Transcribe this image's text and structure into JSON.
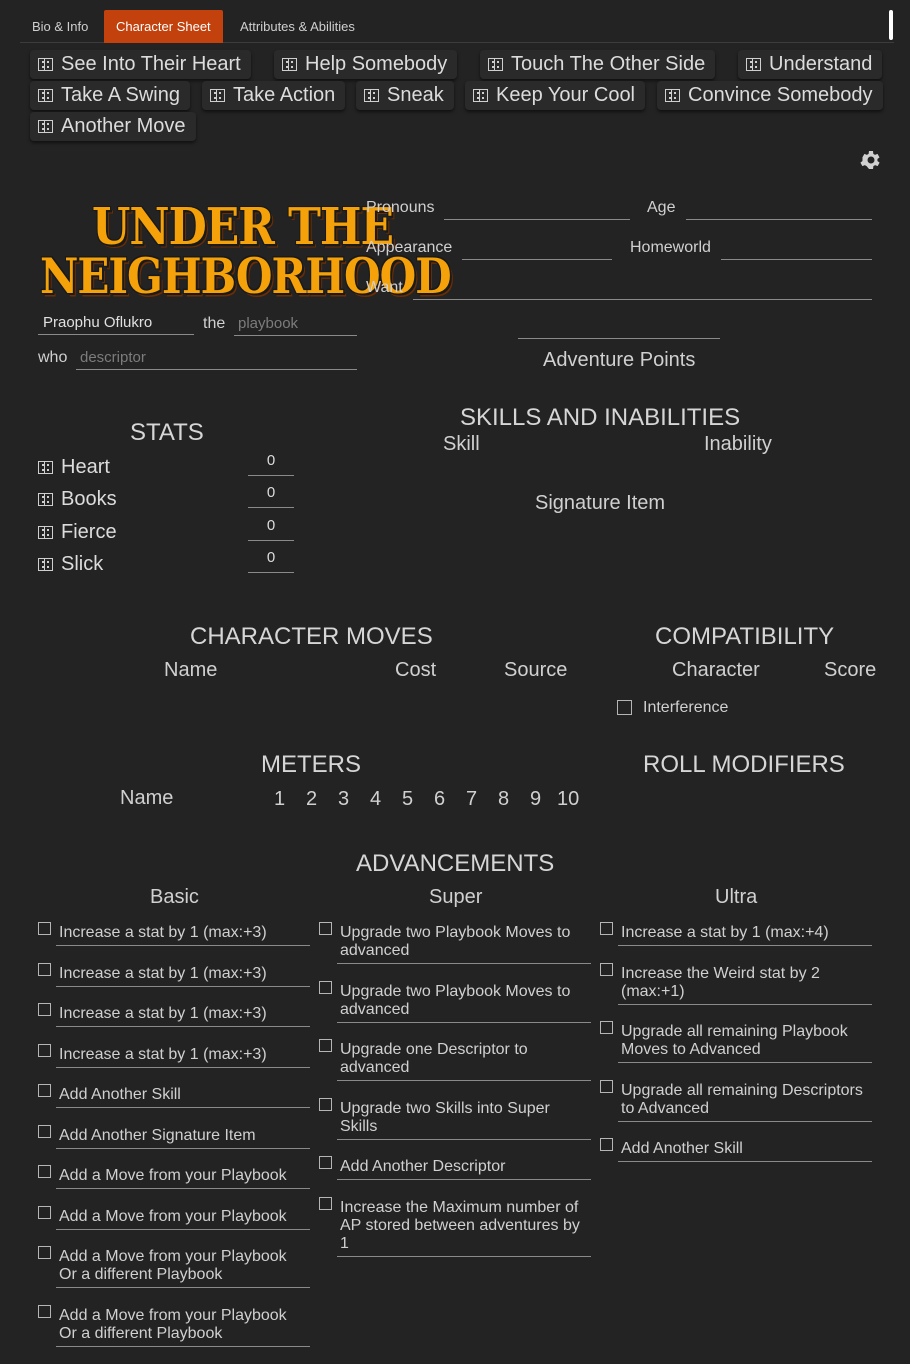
{
  "tabs": [
    "Bio & Info",
    "Character Sheet",
    "Attributes & Abilities"
  ],
  "active_tab": "Character Sheet",
  "moves": [
    "See Into Their Heart",
    "Help Somebody",
    "Touch The Other Side",
    "Understand",
    "Take A Swing",
    "Take Action",
    "Sneak",
    "Keep Your Cool",
    "Convince Somebody",
    "Another Move"
  ],
  "logo": {
    "line1": "UNDER THE",
    "line2": "NEIGHBORHOOD"
  },
  "character": {
    "name": "Praophu Oflukro",
    "the_label": "the",
    "playbook_placeholder": "playbook",
    "who_label": "who",
    "descriptor_placeholder": "descriptor"
  },
  "bio_fields": {
    "pronouns": "Pronouns",
    "age": "Age",
    "appearance": "Appearance",
    "homeworld": "Homeworld",
    "want": "Want"
  },
  "adventure_points_label": "Adventure Points",
  "stats": {
    "title": "STATS",
    "items": [
      {
        "name": "Heart",
        "value": "0"
      },
      {
        "name": "Books",
        "value": "0"
      },
      {
        "name": "Fierce",
        "value": "0"
      },
      {
        "name": "Slick",
        "value": "0"
      }
    ]
  },
  "skills": {
    "title": "SKILLS AND INABILITIES",
    "skill_col": "Skill",
    "inability_col": "Inability",
    "signature_item": "Signature Item"
  },
  "character_moves": {
    "title": "CHARACTER MOVES",
    "cols": [
      "Name",
      "Cost",
      "Source"
    ]
  },
  "compatibility": {
    "title": "COMPATIBILITY",
    "cols": [
      "Character",
      "Score"
    ],
    "interference": "Interference"
  },
  "meters": {
    "title": "METERS",
    "name_col": "Name",
    "numbers": [
      "1",
      "2",
      "3",
      "4",
      "5",
      "6",
      "7",
      "8",
      "9",
      "10"
    ]
  },
  "roll_modifiers": {
    "title": "ROLL MODIFIERS"
  },
  "advancements": {
    "title": "ADVANCEMENTS",
    "basic": {
      "title": "Basic",
      "items": [
        [
          "Increase a stat by 1 (max:+3)"
        ],
        [
          "Increase a stat by 1 (max:+3)"
        ],
        [
          "Increase a stat by 1 (max:+3)"
        ],
        [
          "Increase a stat by 1 (max:+3)"
        ],
        [
          "Add Another Skill"
        ],
        [
          "Add Another Signature Item"
        ],
        [
          "Add a Move from your Playbook"
        ],
        [
          "Add a Move from your Playbook"
        ],
        [
          "Add a Move from your Playbook",
          "Or a different Playbook"
        ],
        [
          "Add a Move from your Playbook",
          "Or a different Playbook"
        ]
      ]
    },
    "super": {
      "title": "Super",
      "items": [
        [
          "Upgrade two Playbook Moves to",
          "advanced"
        ],
        [
          "Upgrade two Playbook Moves to",
          "advanced"
        ],
        [
          "Upgrade one Descriptor to",
          "advanced"
        ],
        [
          "Upgrade two Skills into Super",
          "Skills"
        ],
        [
          "Add Another Descriptor"
        ],
        [
          "Increase the Maximum number of",
          "AP stored between adventures by",
          "1"
        ]
      ]
    },
    "ultra": {
      "title": "Ultra",
      "items": [
        [
          "Increase a stat by 1 (max:+4)"
        ],
        [
          "Increase the Weird stat by 2",
          "(max:+1)"
        ],
        [
          "Upgrade all remaining Playbook",
          "Moves to Advanced"
        ],
        [
          "Upgrade all remaining Descriptors",
          "to Advanced"
        ],
        [
          "Add Another Skill"
        ]
      ]
    }
  }
}
